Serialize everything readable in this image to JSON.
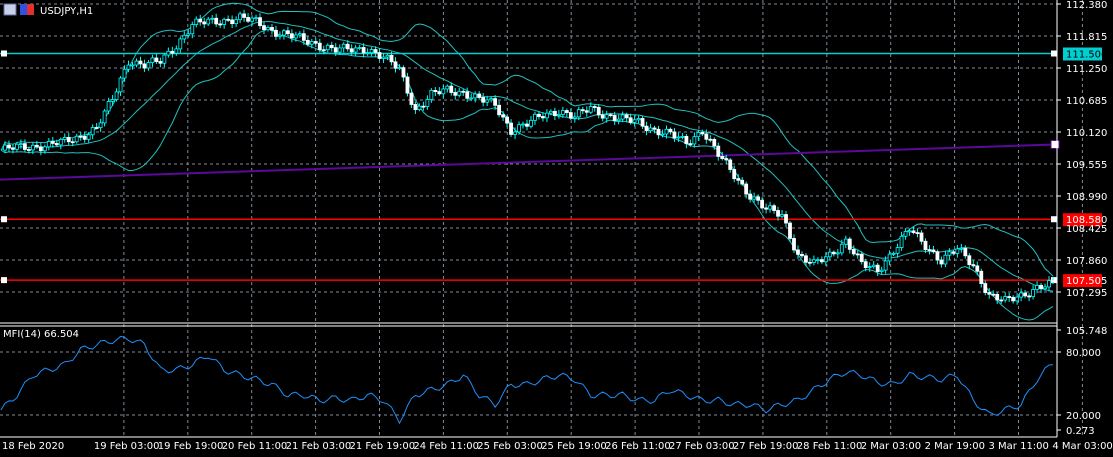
{
  "header": {
    "symbol_label": "USDJPY,H1"
  },
  "indicator": {
    "label": "MFI(14) 66.504"
  },
  "colors": {
    "background": "#000000",
    "grid": "#7f8c99",
    "candle": "#00ffff",
    "bollinger": "#20c0c0",
    "mfi": "#1e90ff",
    "trendline": "#5a0a9a",
    "cyan_level": "#00ced1",
    "red_level": "#ff0000"
  },
  "chart_data": [
    {
      "type": "candlestick",
      "title": "USDJPY,H1",
      "ylim": [
        105.96,
        112.45
      ],
      "y_ticks": [
        "112.380",
        "111.815",
        "111.250",
        "110.685",
        "110.120",
        "109.555",
        "108.990",
        "108.425",
        "107.860",
        "107.295"
      ],
      "x_ticks": [
        "18 Feb 2020",
        "19 Feb 03:00",
        "19 Feb 19:00",
        "20 Feb 11:00",
        "21 Feb 03:00",
        "21 Feb 19:00",
        "24 Feb 11:00",
        "25 Feb 03:00",
        "25 Feb 19:00",
        "26 Feb 11:00",
        "27 Feb 03:00",
        "27 Feb 19:00",
        "28 Feb 11:00",
        "2 Mar 03:00",
        "2 Mar 19:00",
        "3 Mar 11:00",
        "4 Mar 03:00"
      ],
      "close_every_4_bars": [
        109.8,
        109.84,
        109.87,
        109.89,
        109.94,
        110.05,
        110.19,
        110.69,
        111.39,
        111.3,
        111.36,
        111.66,
        112.01,
        112.06,
        112.1,
        112.13,
        112.06,
        111.92,
        111.83,
        111.74,
        111.66,
        111.57,
        111.57,
        111.6,
        111.43,
        111.22,
        110.51,
        110.77,
        110.86,
        110.83,
        110.69,
        110.6,
        110.16,
        110.25,
        110.42,
        110.51,
        110.37,
        110.55,
        110.42,
        110.33,
        110.3,
        110.16,
        110.07,
        109.93,
        110.16,
        109.71,
        109.36,
        109.01,
        108.74,
        108.66,
        107.95,
        107.77,
        107.95,
        108.21,
        107.77,
        107.68,
        108.04,
        108.39,
        108.12,
        107.86,
        108.04,
        107.77,
        107.24,
        107.12,
        107.24,
        107.38,
        107.42
      ],
      "overlays": {
        "bollinger_bands": true
      },
      "levels": [
        {
          "price": 111.506,
          "label": "111.506",
          "color": "#00ced1"
        },
        {
          "price": 108.58,
          "label": "108.580",
          "color": "#ff0000"
        },
        {
          "price": 107.505,
          "label": "107.505",
          "color": "#ff0000"
        }
      ],
      "trendline": {
        "start_price": 109.28,
        "end_price": 109.9
      },
      "grid": true
    },
    {
      "type": "line",
      "title": "MFI(14) 66.504",
      "y_ticks": [
        "105.748",
        "80.000",
        "20.000",
        "0.273"
      ],
      "levels": [
        80,
        20
      ],
      "values_every_4_bars": [
        24.8,
        39,
        58,
        63,
        68,
        82,
        87,
        91,
        93,
        87,
        63,
        63,
        68,
        77,
        63,
        58,
        54,
        49,
        39,
        39,
        34,
        36,
        34,
        39,
        34,
        15,
        39,
        44,
        49,
        58,
        39,
        30,
        49,
        49,
        54,
        58,
        54,
        39,
        39,
        39,
        34,
        34,
        44,
        39,
        34,
        34,
        30,
        30,
        25,
        30,
        34,
        44,
        54,
        61,
        58,
        51,
        49,
        58,
        56,
        54,
        58,
        34,
        20,
        25,
        30,
        54,
        70
      ],
      "grid": true
    }
  ]
}
